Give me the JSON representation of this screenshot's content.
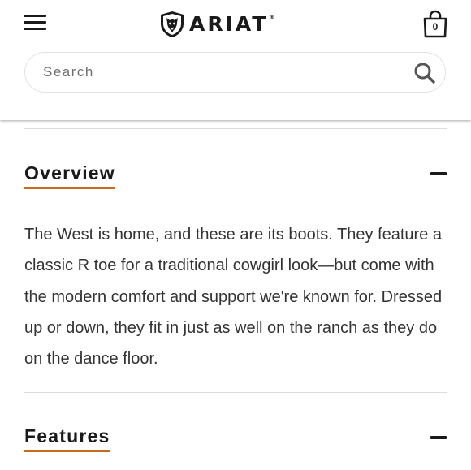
{
  "header": {
    "brand": "ARIAT",
    "brand_mark": "®",
    "cart_count": "0"
  },
  "search": {
    "placeholder": "Search",
    "value": ""
  },
  "overview": {
    "title": "Overview",
    "body": "The West is home, and these are its boots. They feature a classic R toe for a traditional cowgirl look—but come with the modern comfort and support we're known for. Dressed up or down, they fit in just as well on the ranch as they do on the dance floor."
  },
  "features": {
    "title": "Features"
  },
  "colors": {
    "accent_underline": "#c96a1f",
    "text_dark": "#1a1a1a",
    "body_text": "#333333",
    "divider": "#dcdcdc"
  },
  "icons": {
    "menu": "hamburger-menu-icon",
    "logo": "ariat-horse-shield-icon",
    "cart": "shopping-bag-icon",
    "search": "magnifier-icon",
    "collapse": "minus-icon"
  }
}
